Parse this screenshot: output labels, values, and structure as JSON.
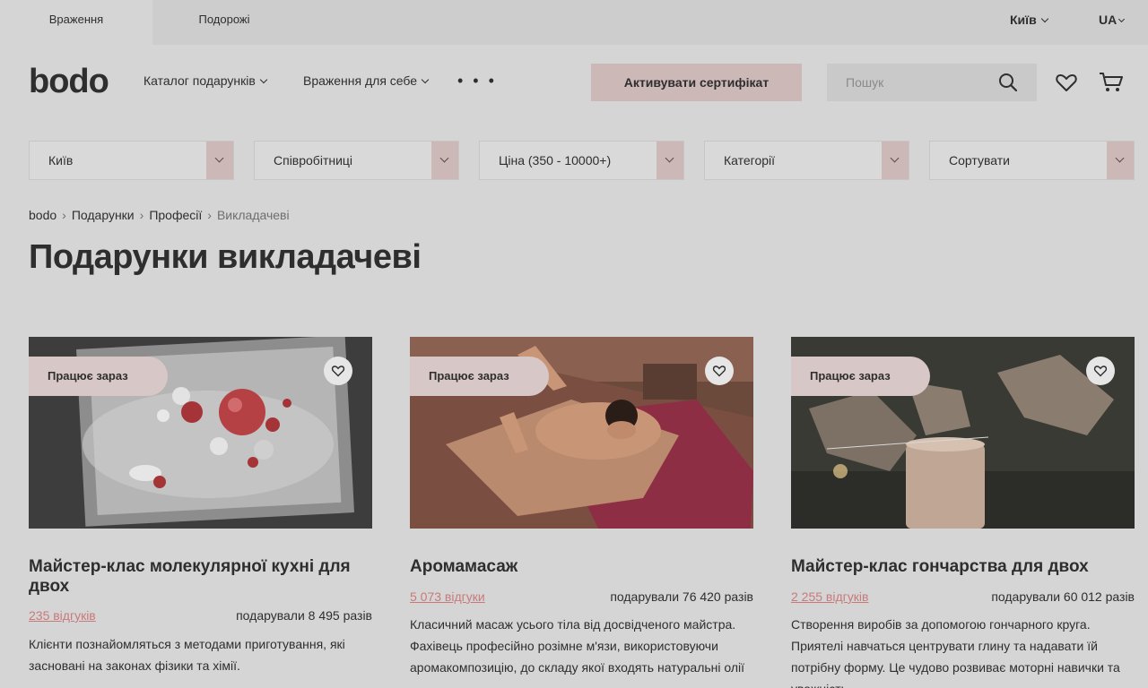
{
  "topbar": {
    "tabs": [
      {
        "label": "Враження"
      },
      {
        "label": "Подорожі"
      }
    ],
    "city": "Київ",
    "lang": "UA"
  },
  "header": {
    "logo": "bodo",
    "nav": [
      {
        "label": "Каталог подарунків"
      },
      {
        "label": "Враження для себе"
      }
    ],
    "more": "• • •",
    "activate_label": "Активувати сертифікат",
    "search_placeholder": "Пошук"
  },
  "filters": [
    {
      "label": "Київ"
    },
    {
      "label": "Співробітниці"
    },
    {
      "label": "Ціна (350 - 10000+)"
    },
    {
      "label": "Категорії"
    },
    {
      "label": "Сортувати"
    }
  ],
  "breadcrumb": [
    "bodo",
    "Подарунки",
    "Професії",
    "Викладачеві"
  ],
  "page_title": "Подарунки викладачеві",
  "cards": [
    {
      "badge": "Працює зараз",
      "title": "Майстер-клас молекулярної кухні для двох",
      "reviews": "235 відгуків",
      "gifted": "подарували 8 495 разів",
      "desc": "Клієнти познайомляться з методами приготування, які засновані на законах фізики та хімії."
    },
    {
      "badge": "Працює зараз",
      "title": "Аромамасаж",
      "reviews": "5 073 відгуки",
      "gifted": "подарували 76 420 разів",
      "desc": "Класичний масаж усього тіла від досвідченого майстра. Фахівець професійно розімне м'язи, використовуючи аромакомпозицію, до складу якої входять натуральні олії"
    },
    {
      "badge": "Працює зараз",
      "title": "Майстер-клас гончарства для двох",
      "reviews": "2 255 відгуків",
      "gifted": "подарували 60 012 разів",
      "desc": "Створення виробів за допомогою гончарного круга. Приятелі навчаться центрувати глину та надавати їй потрібну форму. Це чудово розвиває моторні навички та уважність"
    }
  ]
}
